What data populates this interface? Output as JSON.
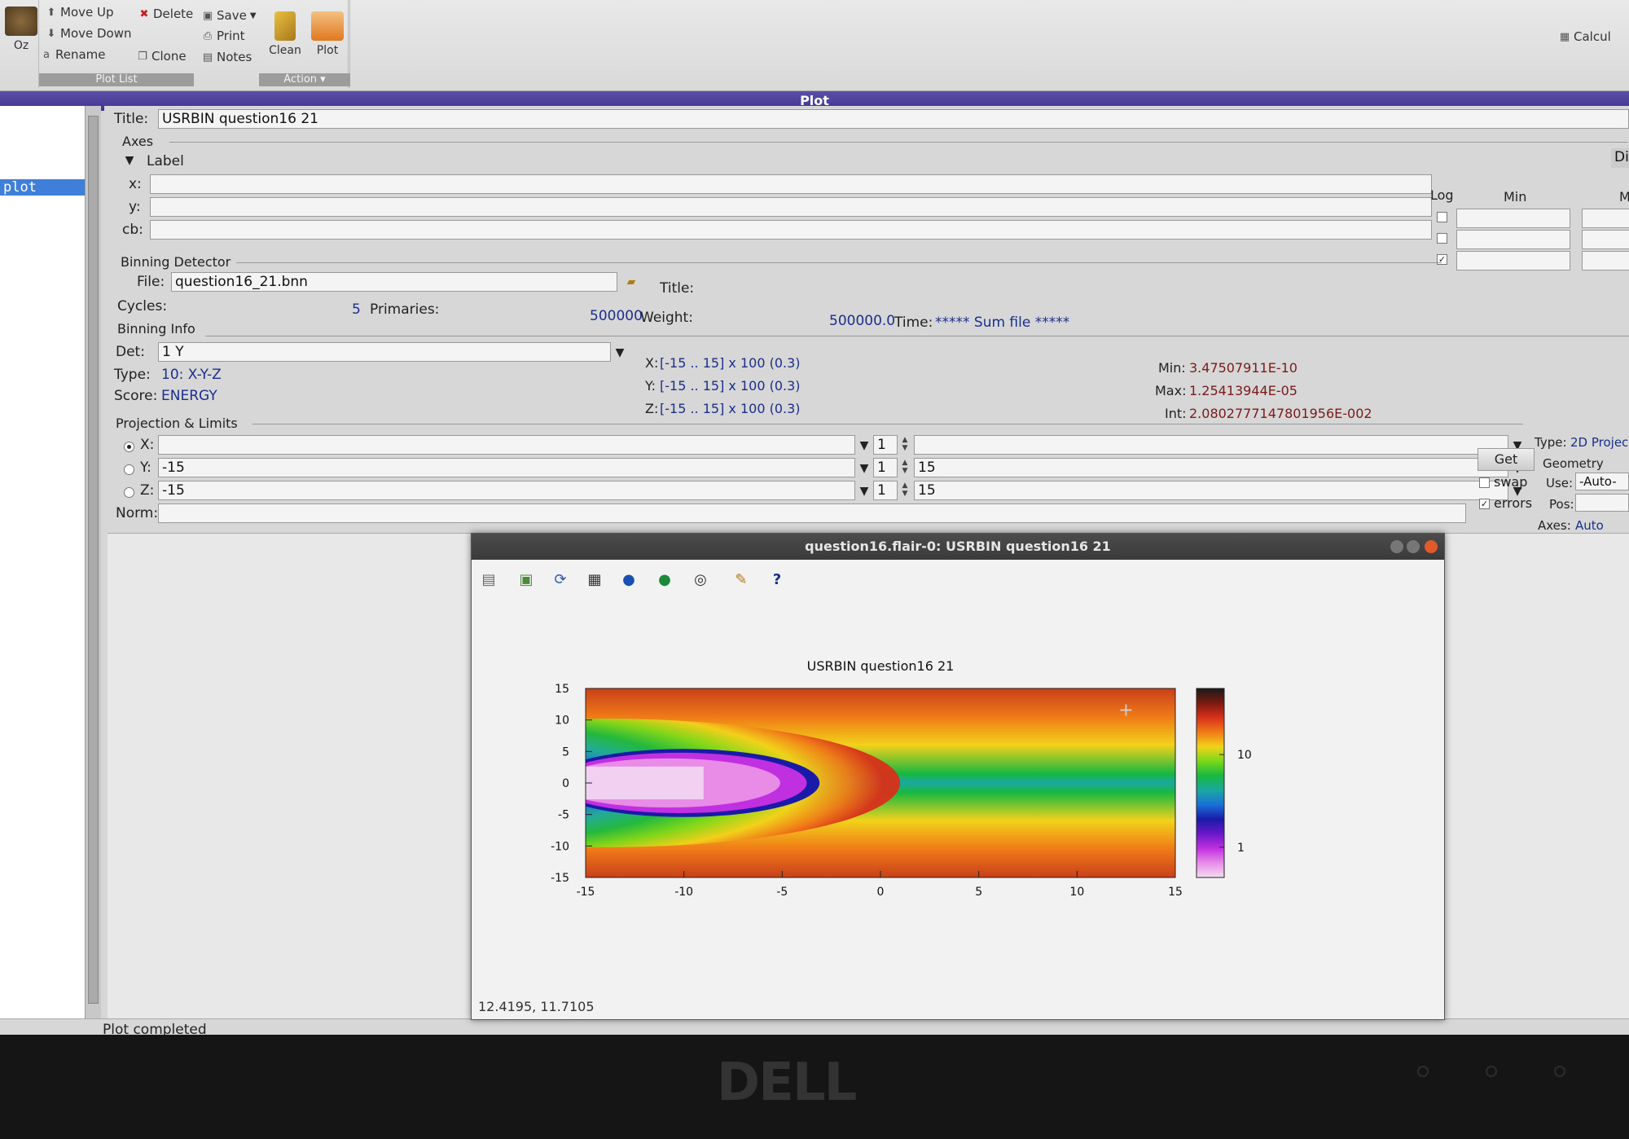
{
  "ribbon": {
    "oz_label": "Oz",
    "move_up": "Move Up",
    "move_down": "Move Down",
    "rename": "Rename",
    "delete": "Delete",
    "clone": "Clone",
    "save": "Save",
    "print": "Print",
    "notes": "Notes",
    "clean": "Clean",
    "plot": "Plot",
    "group_plot_list": "Plot List",
    "group_action": "Action",
    "calc": "Calcul"
  },
  "window_title": "Plot",
  "plot_list": {
    "selected": "plot"
  },
  "form": {
    "title_label": "Title:",
    "title_value": "USRBIN question16 21",
    "axes_section": "Axes",
    "label_toggle": "Label",
    "x_label": "x:",
    "y_label": "y:",
    "cb_label": "cb:",
    "log_header": "Log",
    "min_header": "Min",
    "dis_label": "Dis",
    "max_header_partial": "M",
    "binning_detector_section": "Binning Detector",
    "file_label": "File:",
    "file_value": "question16_21.bnn",
    "title2_label": "Title:",
    "cycles_label": "Cycles:",
    "cycles_value": "5",
    "primaries_label": "Primaries:",
    "primaries_value": "500000",
    "weight_label": "Weight:",
    "weight_value": "500000.0",
    "time_label": "Time:",
    "time_value": "***** Sum file *****",
    "binning_info_section": "Binning Info",
    "det_label": "Det:",
    "det_value": "1 Y",
    "type_label": "Type:",
    "type_value": "10: X-Y-Z",
    "score_label": "Score:",
    "score_value": "ENERGY",
    "x_range_label": "X:",
    "x_range": "[-15 .. 15] x 100 (0.3)",
    "y_range_label": "Y:",
    "y_range": "[-15 .. 15] x 100 (0.3)",
    "z_range_label": "Z:",
    "z_range": "[-15 .. 15] x 100 (0.3)",
    "min_label": "Min:",
    "min_value": "3.47507911E-10",
    "max_label": "Max:",
    "max_value": "1.25413944E-05",
    "int_label": "Int:",
    "int_value": "2.0802777147801956E-002",
    "projection_section": "Projection & Limits",
    "proj_x_label": "X:",
    "proj_y_label": "Y:",
    "proj_y_value": "-15",
    "proj_z_label": "Z:",
    "proj_z_value": "-15",
    "norm_label": "Norm:",
    "x_rebin": "1",
    "y_rebin": "1",
    "z_rebin": "1",
    "y_max": "15",
    "z_max": "15",
    "get_button": "Get",
    "swap_label": "swap",
    "errors_label": "errors",
    "type_right_label": "Type:",
    "type_right_value": "2D Projec",
    "geometry_label": "Geometry",
    "use_label": "Use:",
    "use_value": "-Auto-",
    "pos_label": "Pos:",
    "axes_label": "Axes:",
    "axes_value": "Auto"
  },
  "status": "Plot completed",
  "plot_window": {
    "title": "question16.flair-0: USRBIN question16 21",
    "coords": "12.4195,  11.7105"
  },
  "chart_data": {
    "type": "heatmap",
    "title": "USRBIN question16 21",
    "xlim": [
      -15,
      15
    ],
    "ylim": [
      -15,
      15
    ],
    "x_ticks": [
      "-15",
      "-10",
      "-5",
      "0",
      "5",
      "10",
      "15"
    ],
    "y_ticks": [
      "15",
      "10",
      "5",
      "0",
      "-5",
      "-10",
      "-15"
    ],
    "colorbar_ticks": [
      "10",
      "1"
    ],
    "colorbar_scale": "log",
    "colors": [
      "#1a1a1a",
      "#7a1a10",
      "#d8301a",
      "#f07a18",
      "#f2d21a",
      "#7ad81a",
      "#18b840",
      "#1aa8a0",
      "#1a70d8",
      "#1a1aa8",
      "#6a18c8",
      "#c030e0",
      "#e88ce8",
      "#f2dcf2"
    ]
  }
}
